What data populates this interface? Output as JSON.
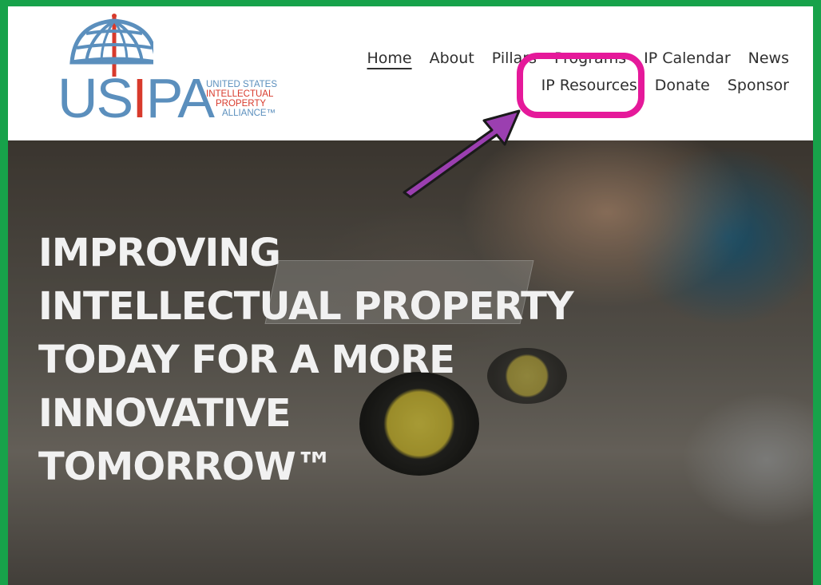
{
  "logo": {
    "word_part1": "US",
    "word_part2": "I",
    "word_part3": "PA",
    "subtitle": [
      "UNITED STATES",
      "INTELLECTUAL",
      "PROPERTY",
      "ALLIANCE™"
    ]
  },
  "nav": {
    "row1": [
      {
        "label": "Home",
        "active": true
      },
      {
        "label": "About"
      },
      {
        "label": "Pillars"
      },
      {
        "label": "Programs"
      },
      {
        "label": "IP Calendar"
      },
      {
        "label": "News"
      }
    ],
    "row2": [
      {
        "label": "IP Resources"
      },
      {
        "label": "Donate"
      },
      {
        "label": "Sponsor"
      }
    ]
  },
  "hero": {
    "lines": [
      "IMPROVING",
      "INTELLECTUAL PROPERTY",
      "TODAY FOR A MORE",
      "INNOVATIVE",
      "TOMORROW™"
    ]
  },
  "colors": {
    "frame": "#17a24a",
    "logo_blue": "#5b8fbd",
    "logo_red": "#d83a2c",
    "highlight": "#e5199a",
    "arrow": "#9b3fb0"
  }
}
